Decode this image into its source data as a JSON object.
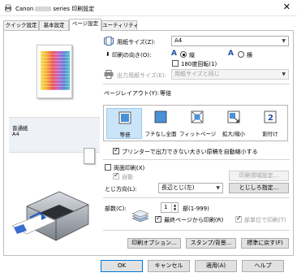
{
  "window": {
    "title_prefix": "Canon",
    "title_suffix": "series 印刷設定",
    "close_glyph": "✕"
  },
  "tabs": [
    {
      "label": "クイック設定",
      "active": false
    },
    {
      "label": "基本設定",
      "active": false
    },
    {
      "label": "ページ設定",
      "active": true
    },
    {
      "label": "ユーティリティ",
      "active": false
    }
  ],
  "preview": {
    "media_type": "普通紙",
    "paper_size": "A4"
  },
  "page_size": {
    "label": "用紙サイズ(Z):",
    "value": "A4"
  },
  "orientation": {
    "label": "印刷の向き(O):",
    "portrait_label": "縦",
    "landscape_label": "横",
    "rotate_label": "180度回転(1)",
    "selected": "portrait"
  },
  "output_size": {
    "label": "出力用紙サイズ(E):",
    "value": "用紙サイズと同じ"
  },
  "page_layout": {
    "label": "ページレイアウト(Y):",
    "current": "等倍",
    "items": [
      {
        "label": "等倍",
        "icon": "normal-size-icon",
        "selected": true
      },
      {
        "label": "フチなし全面",
        "icon": "borderless-icon",
        "selected": false
      },
      {
        "label": "フィットページ",
        "icon": "fit-to-page-icon",
        "selected": false
      },
      {
        "label": "拡大/縮小",
        "icon": "scaled-icon",
        "selected": false
      },
      {
        "label": "割付け",
        "icon": "page-layout-icon",
        "selected": false
      }
    ]
  },
  "reduce_large": {
    "label": "プリンターで出力できない大きい原稿を自動縮小する",
    "checked": true
  },
  "duplex": {
    "label": "両面印刷(X)",
    "auto_label": "自動",
    "area_button": "印刷領域設定...",
    "checked": false
  },
  "stapling": {
    "label": "とじ方向(L):",
    "value": "長辺とじ(左)",
    "margin_button": "とじしろ指定..."
  },
  "copies": {
    "label": "部数(C):",
    "value": "1",
    "range": "部(1-999)",
    "last_page_first_label": "最終ページから印刷(R)",
    "last_page_first_checked": true,
    "collate_label": "部単位で印刷(T)",
    "collate_checked": true
  },
  "actions": {
    "print_options": "印刷オプション...",
    "stamp_background": "スタンプ/背景...",
    "defaults": "標準に戻す(F)"
  },
  "footer": {
    "ok": "OK",
    "cancel": "キャンセル",
    "apply": "適用(A)",
    "help": "ヘルプ"
  }
}
